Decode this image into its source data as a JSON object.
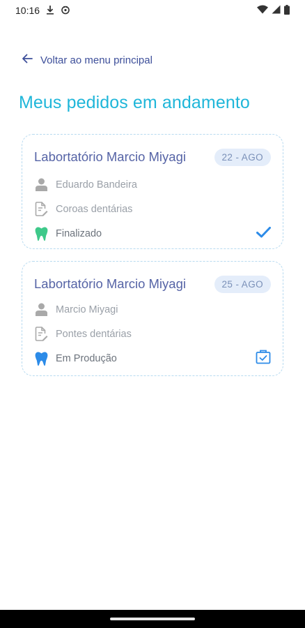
{
  "status_bar": {
    "time": "10:16"
  },
  "nav": {
    "back_label": "Voltar ao menu principal"
  },
  "page": {
    "title": "Meus pedidos em andamento"
  },
  "orders": [
    {
      "lab": "Labortatório Marcio Miyagi",
      "date": "22 - AGO",
      "patient": "Eduardo Bandeira",
      "product": "Coroas dentárias",
      "status": "Finalizado",
      "status_color": "#3ec98a",
      "action_icon": "checkmark-icon"
    },
    {
      "lab": "Labortatório Marcio Miyagi",
      "date": "25 - AGO",
      "patient": "Marcio Miyagi",
      "product": "Pontes dentárias",
      "status": "Em Produção",
      "status_color": "#2c8be8",
      "action_icon": "clipboard-check-icon"
    }
  ],
  "colors": {
    "title": "#1fb6d9",
    "lab_name": "#5664a6",
    "badge_bg": "#e4edfa",
    "card_border": "#b7daf0"
  }
}
